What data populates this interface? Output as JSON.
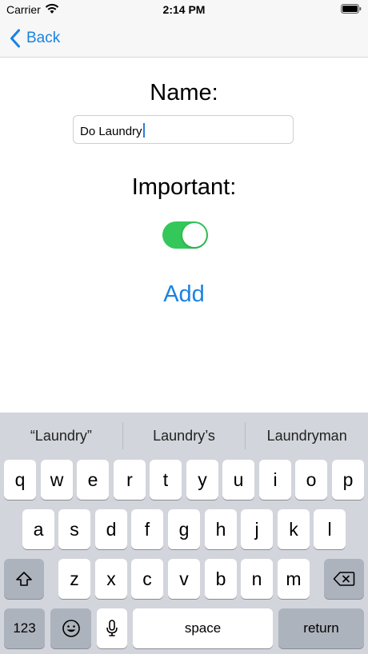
{
  "status_bar": {
    "carrier": "Carrier",
    "time": "2:14 PM"
  },
  "nav": {
    "back_label": "Back"
  },
  "form": {
    "name_label": "Name:",
    "name_value": "Do Laundry",
    "important_label": "Important:",
    "important_on": true,
    "add_label": "Add"
  },
  "keyboard": {
    "suggestions": [
      "“Laundry”",
      "Laundry’s",
      "Laundryman"
    ],
    "row1": [
      "q",
      "w",
      "e",
      "r",
      "t",
      "y",
      "u",
      "i",
      "o",
      "p"
    ],
    "row2": [
      "a",
      "s",
      "d",
      "f",
      "g",
      "h",
      "j",
      "k",
      "l"
    ],
    "row3": [
      "z",
      "x",
      "c",
      "v",
      "b",
      "n",
      "m"
    ],
    "numbers_key": "123",
    "space_key": "space",
    "return_key": "return"
  },
  "colors": {
    "accent": "#1a82e2",
    "toggle_on": "#34c759",
    "keyboard_bg": "#d2d5db"
  }
}
